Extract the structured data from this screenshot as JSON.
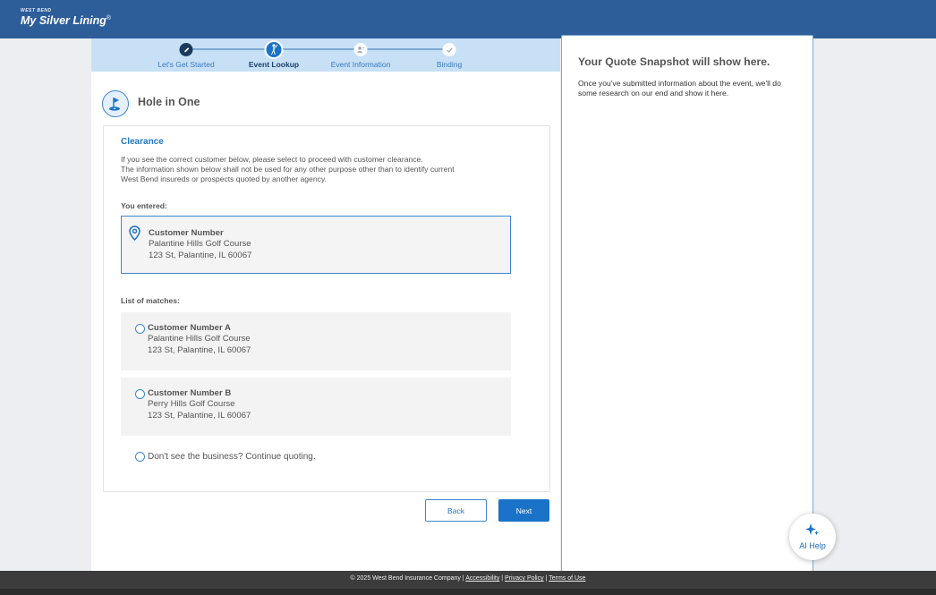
{
  "brand": {
    "small": "WEST BEND",
    "name": "My Silver Lining",
    "mark": "®"
  },
  "stepper": {
    "steps": [
      {
        "label": "Let's Get Started",
        "status": "complete",
        "icon": "pencil-icon"
      },
      {
        "label": "Event Lookup",
        "status": "active",
        "icon": "golfer-icon"
      },
      {
        "label": "Event Information",
        "status": "upcoming",
        "icon": "person-icon"
      },
      {
        "label": "Binding",
        "status": "upcoming",
        "icon": "check-icon"
      }
    ]
  },
  "page": {
    "title": "Hole in One",
    "icon": "golf-flag-icon"
  },
  "clearance": {
    "heading": "Clearance",
    "description_1": "If you see the correct customer below, please select to proceed with customer clearance.",
    "description_2": "The information shown below shall not be used for any other purpose other than to identify current",
    "description_3": "West Bend insureds or prospects quoted by another agency.",
    "entered_label": "You entered:",
    "entered": {
      "name": "Customer Number",
      "line1": "Palantine Hills Golf Course",
      "line2": "123 St, Palantine, IL 60067"
    },
    "matches_label": "List of matches:",
    "matches": [
      {
        "name": "Customer Number A",
        "line1": "Palantine Hills Golf Course",
        "line2": "123 St, Palantine, IL 60067"
      },
      {
        "name": "Customer Number B",
        "line1": "Perry Hills Golf Course",
        "line2": "123 St, Palantine, IL 60067"
      }
    ],
    "no_match": "Don't see the business? Continue quoting."
  },
  "buttons": {
    "back": "Back",
    "next": "Next"
  },
  "snapshot": {
    "title": "Your Quote Snapshot will show here.",
    "text": "Once you've submitted information about the event, we'll do some research on our end and show it here."
  },
  "ai_help": {
    "label": "AI Help",
    "icon": "sparkle-icon"
  },
  "footer": {
    "copyright": "© 2025 West Bend Insurance Company |",
    "accessibility": "Accessibility",
    "privacy": "Privacy Policy",
    "terms": "Terms of Use"
  },
  "colors": {
    "header": "#2d5e9a",
    "accent": "#1a73c8",
    "stepper_bg": "#c7e0f6"
  }
}
